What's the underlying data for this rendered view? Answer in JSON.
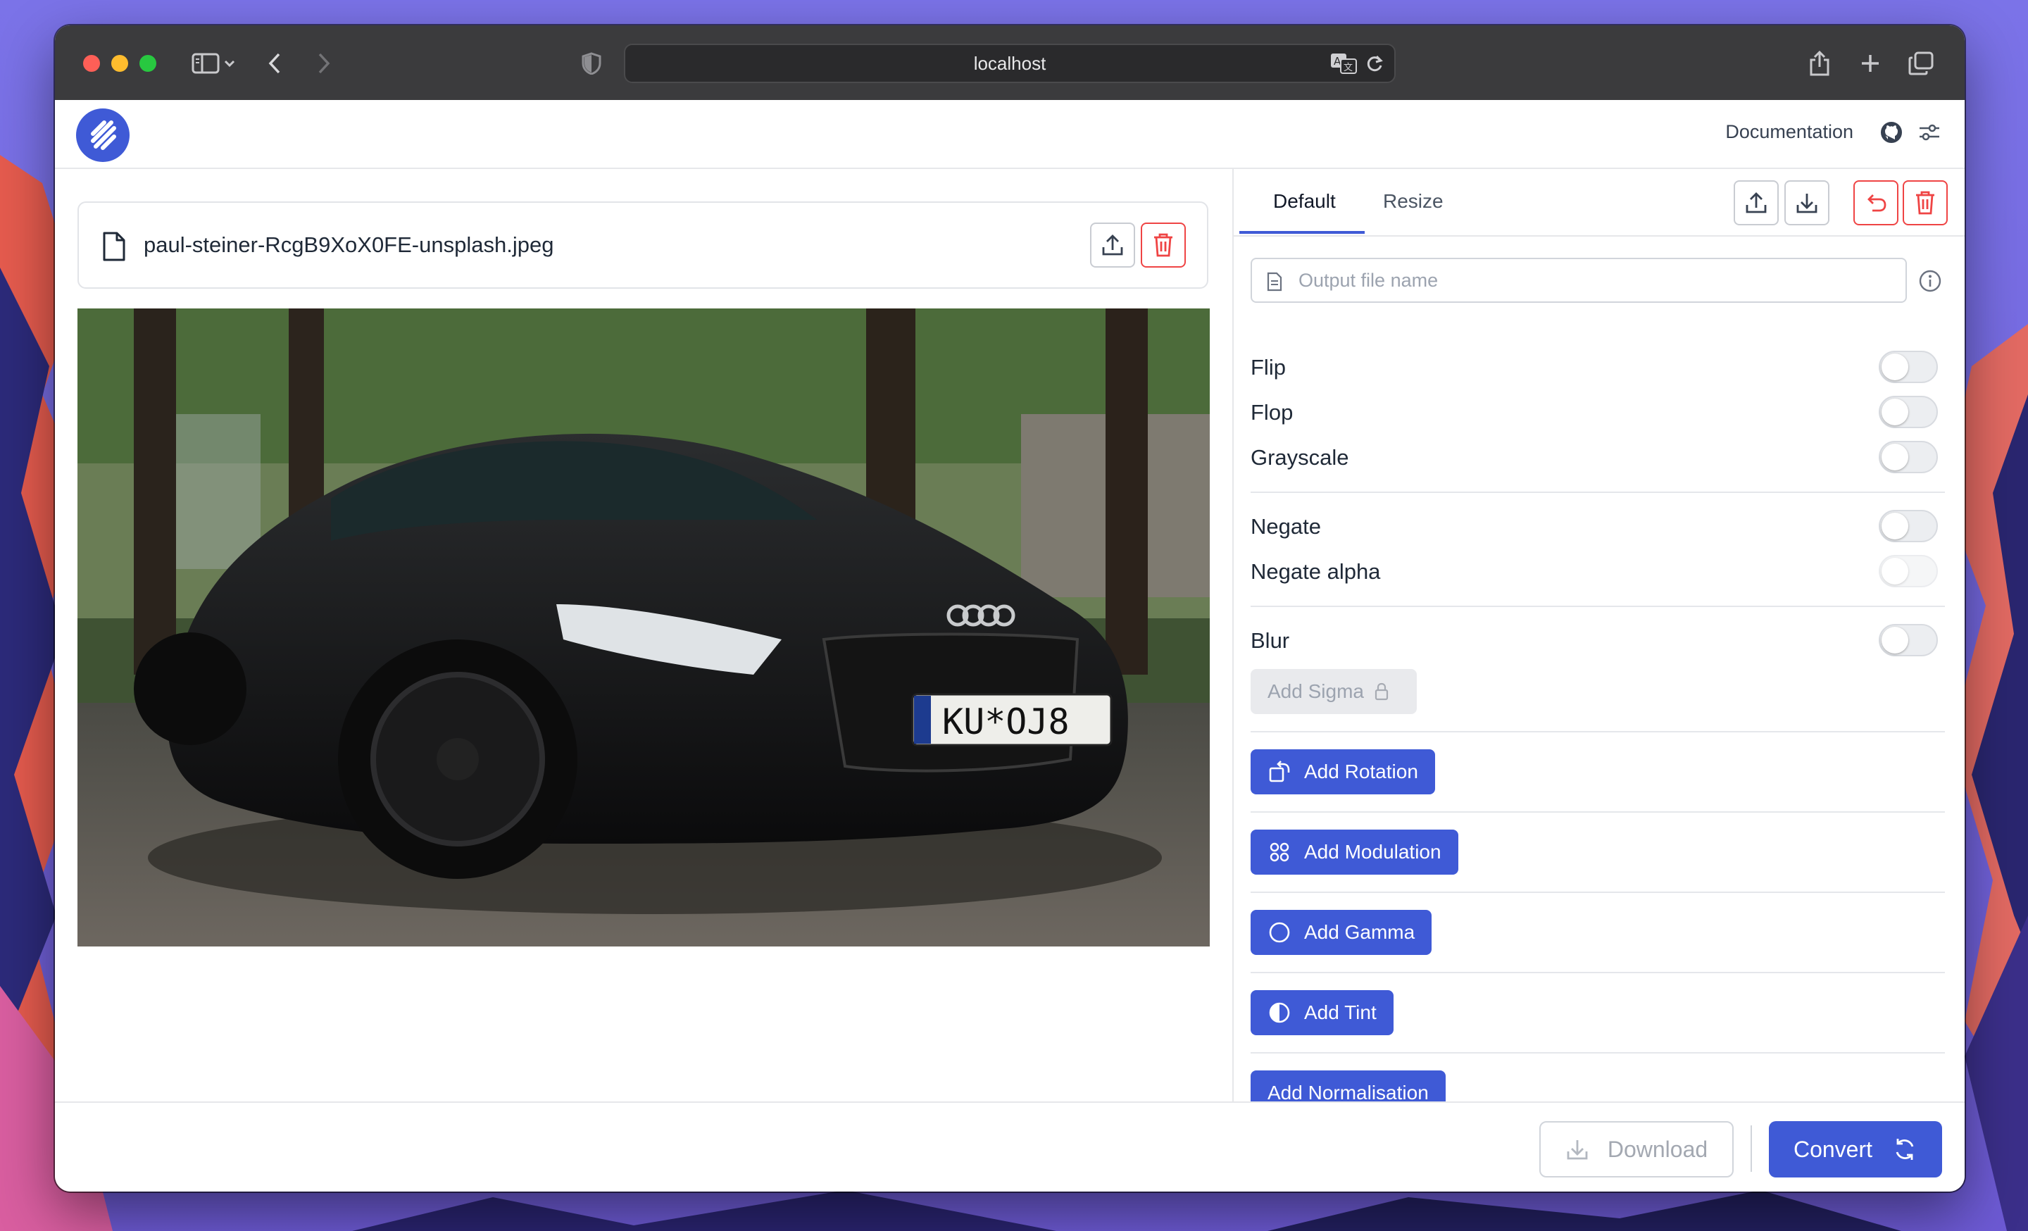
{
  "browser": {
    "url": "localhost"
  },
  "header": {
    "documentation_label": "Documentation"
  },
  "file": {
    "name": "paul-steiner-RcgB9XoX0FE-unsplash.jpeg"
  },
  "tabs": [
    {
      "label": "Default",
      "active": true
    },
    {
      "label": "Resize",
      "active": false
    }
  ],
  "output": {
    "placeholder": "Output file name",
    "value": ""
  },
  "options": {
    "flip": {
      "label": "Flip",
      "on": false
    },
    "flop": {
      "label": "Flop",
      "on": false
    },
    "grayscale": {
      "label": "Grayscale",
      "on": false
    },
    "negate": {
      "label": "Negate",
      "on": false
    },
    "negate_alpha": {
      "label": "Negate alpha",
      "on": false,
      "disabled": true
    },
    "blur": {
      "label": "Blur",
      "on": false
    }
  },
  "buttons": {
    "add_sigma": "Add Sigma",
    "add_rotation": "Add Rotation",
    "add_modulation": "Add Modulation",
    "add_gamma": "Add Gamma",
    "add_tint": "Add Tint",
    "add_normalisation": "Add Normalisation"
  },
  "footer": {
    "download_label": "Download",
    "convert_label": "Convert"
  },
  "colors": {
    "accent": "#3f5ad6",
    "danger": "#ef4444"
  },
  "icons": [
    "sidebar-icon",
    "chevron-down-icon",
    "back-icon",
    "forward-icon",
    "shield-icon",
    "translate-icon",
    "reload-icon",
    "share-icon",
    "new-tab-icon",
    "tabs-overview-icon",
    "logo-icon",
    "github-icon",
    "settings-sliders-icon",
    "file-icon",
    "upload-icon",
    "trash-icon",
    "download-icon",
    "undo-icon",
    "document-icon",
    "info-icon",
    "lock-icon",
    "rotate-icon",
    "grid-icon",
    "circle-icon",
    "half-circle-icon",
    "refresh-icon"
  ]
}
